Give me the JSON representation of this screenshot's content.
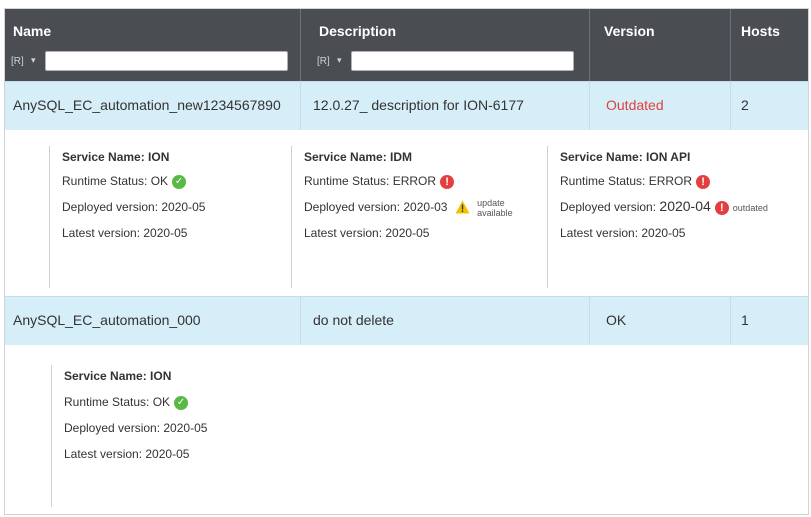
{
  "header": {
    "name": "Name",
    "description": "Description",
    "version": "Version",
    "hosts": "Hosts",
    "filter_icon": "[R]",
    "filter_caret": "▾"
  },
  "rows": [
    {
      "name": "AnySQL_EC_automation_new1234567890",
      "description": "12.0.27_ description for ION-6177",
      "version": "Outdated",
      "version_color": "#e1403f",
      "hosts": "2",
      "services": [
        {
          "name": "Service Name: ION",
          "runtime": "Runtime Status: OK",
          "runtime_icon": "check-icon",
          "deployed": "Deployed version: 2020-05",
          "latest": "Latest version: 2020-05"
        },
        {
          "name": "Service Name: IDM",
          "runtime": "Runtime Status: ERROR",
          "runtime_icon": "error-icon",
          "deployed": "Deployed version: 2020-03",
          "deployed_icon": "warning-icon",
          "deployed_note_1": "update",
          "deployed_note_2": "available",
          "latest": "Latest version: 2020-05"
        },
        {
          "name": "Service Name: ION API",
          "runtime": "Runtime Status: ERROR",
          "runtime_icon": "error-icon",
          "deployed_prefix": "Deployed version:",
          "deployed_value": "2020-04",
          "deployed_icon": "error-icon",
          "deployed_note": "outdated",
          "latest": "Latest version: 2020-05"
        }
      ]
    },
    {
      "name": "AnySQL_EC_automation_000",
      "description": "do not delete",
      "version": "OK",
      "hosts": "1",
      "services": [
        {
          "name": "Service Name: ION",
          "runtime": "Runtime Status: OK",
          "runtime_icon": "check-icon",
          "deployed": "Deployed version: 2020-05",
          "latest": "Latest version: 2020-05"
        }
      ]
    }
  ],
  "colors": {
    "header_bg": "#4a4d52",
    "row_bg": "#d6eef8",
    "ok": "#58b947",
    "error": "#e1403f",
    "warning": "#f2c200"
  }
}
